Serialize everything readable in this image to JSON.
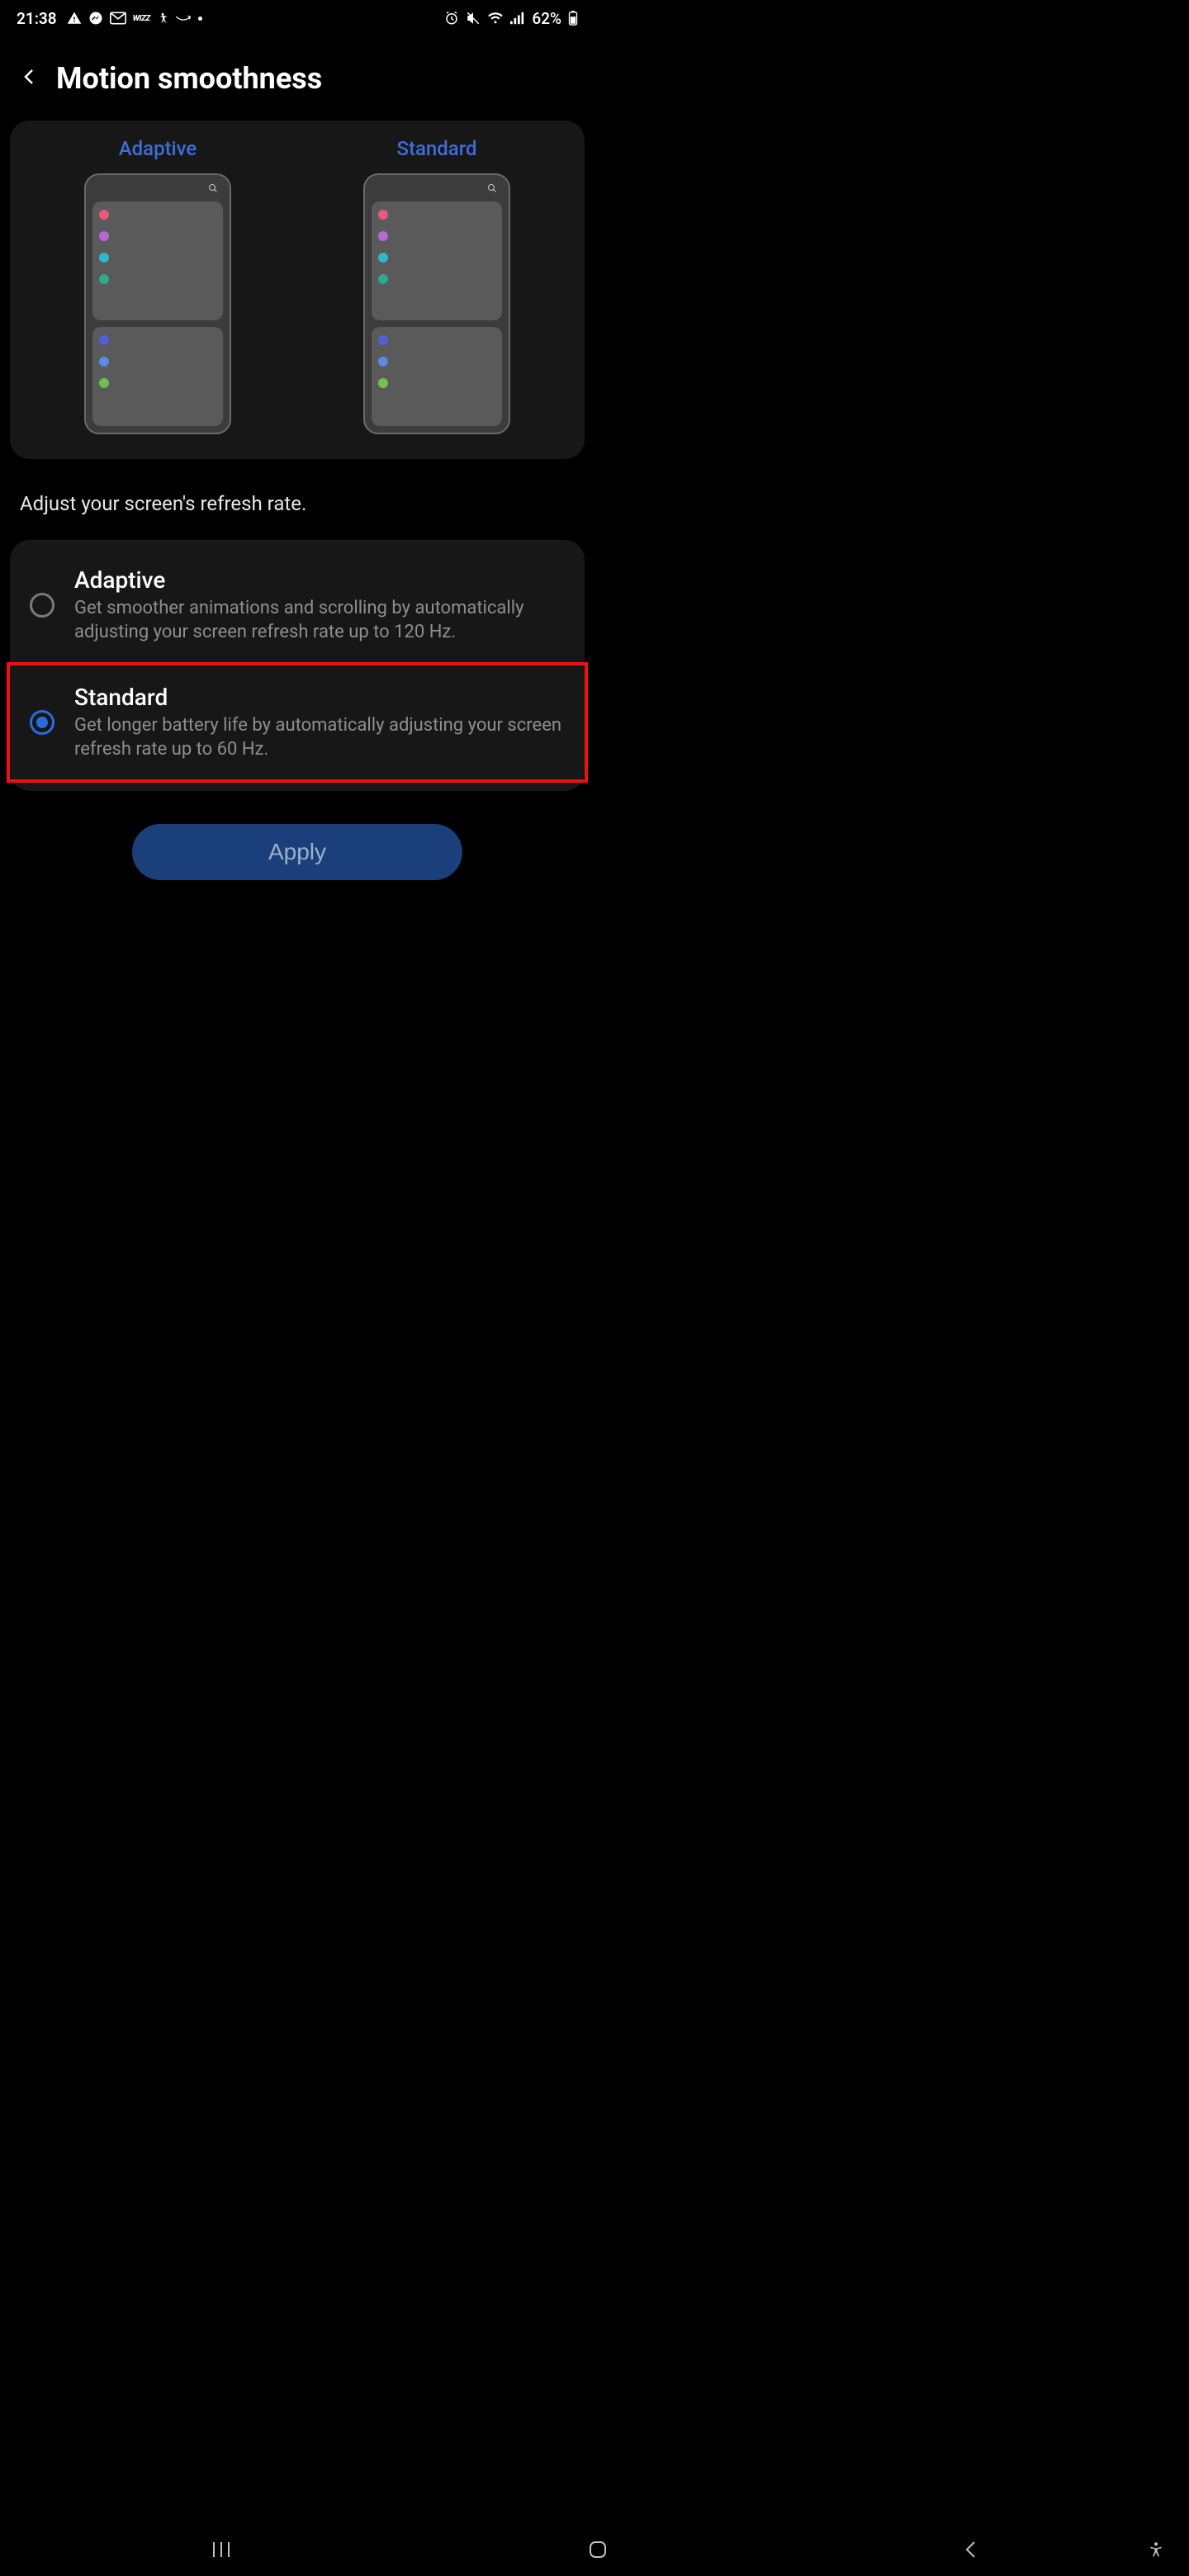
{
  "status": {
    "time": "21:38",
    "battery": "62%",
    "icons_left": [
      "warning",
      "messenger",
      "gmail",
      "wizz",
      "accessibility",
      "amazon",
      "dot"
    ],
    "icons_right": [
      "alarm",
      "mute",
      "wifi",
      "signal"
    ]
  },
  "header": {
    "title": "Motion smoothness"
  },
  "preview": {
    "left_label": "Adaptive",
    "right_label": "Standard"
  },
  "section_text": "Adjust your screen's refresh rate.",
  "options": [
    {
      "id": "adaptive",
      "title": "Adaptive",
      "desc": "Get smoother animations and scrolling by automatically adjusting your screen refresh rate up to 120 Hz.",
      "selected": false,
      "highlighted": false
    },
    {
      "id": "standard",
      "title": "Standard",
      "desc": "Get longer battery life by automatically adjusting your screen refresh rate up to 60 Hz.",
      "selected": true,
      "highlighted": true
    }
  ],
  "apply_label": "Apply"
}
